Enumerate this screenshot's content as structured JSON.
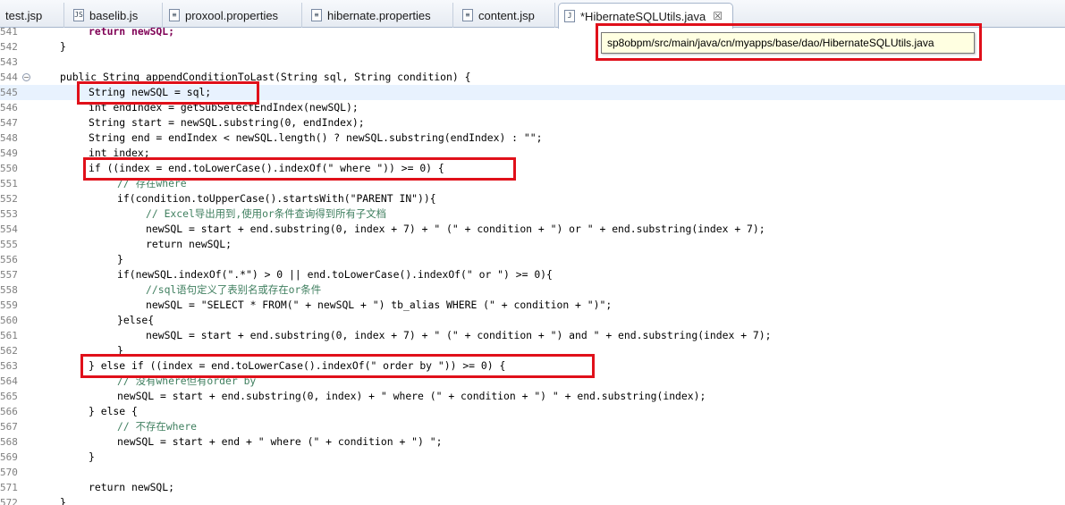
{
  "tabs": [
    {
      "label": "test.jsp",
      "icon": "jsp-file-icon"
    },
    {
      "label": "baselib.js",
      "icon": "js-file-icon"
    },
    {
      "label": "proxool.properties",
      "icon": "properties-file-icon"
    },
    {
      "label": "hibernate.properties",
      "icon": "properties-file-icon"
    },
    {
      "label": "content.jsp",
      "icon": "jsp-file-icon"
    },
    {
      "label": "*HibernateSQLUtils.java",
      "icon": "java-file-icon",
      "close": "☒"
    }
  ],
  "tooltip": "sp8obpm/src/main/java/cn/myapps/base/dao/HibernateSQLUtils.java",
  "annotation_color": "#e0101a",
  "current_line_color": "#e8f2fe",
  "lines": [
    {
      "num": "541",
      "code": "return newSQL;"
    },
    {
      "num": "542",
      "code": "}"
    },
    {
      "num": "543",
      "code": ""
    },
    {
      "num": "544",
      "code": "public String appendConditionToLast(String sql, String condition) {"
    },
    {
      "num": "545",
      "code": "String newSQL = sql;"
    },
    {
      "num": "546",
      "code": "int endIndex = getSubSelectEndIndex(newSQL);"
    },
    {
      "num": "547",
      "code": "String start = newSQL.substring(0, endIndex);"
    },
    {
      "num": "548",
      "code": "String end = endIndex < newSQL.length() ? newSQL.substring(endIndex) : \"\";"
    },
    {
      "num": "549",
      "code": "int index;"
    },
    {
      "num": "550",
      "code": "if ((index = end.toLowerCase().indexOf(\" where \")) >= 0) {"
    },
    {
      "num": "551",
      "code": "// 存在where"
    },
    {
      "num": "552",
      "code": "if(condition.toUpperCase().startsWith(\"PARENT IN\")){"
    },
    {
      "num": "553",
      "code": "// Excel导出用到,使用or条件查询得到所有子文档"
    },
    {
      "num": "554",
      "code": "newSQL = start + end.substring(0, index + 7) + \" (\" + condition + \") or \" + end.substring(index + 7);"
    },
    {
      "num": "555",
      "code": "return newSQL;"
    },
    {
      "num": "556",
      "code": "}"
    },
    {
      "num": "557",
      "code": "if(newSQL.indexOf(\".*\") > 0 || end.toLowerCase().indexOf(\" or \") >= 0){"
    },
    {
      "num": "558",
      "code": "//sql语句定义了表别名或存在or条件"
    },
    {
      "num": "559",
      "code": "newSQL = \"SELECT * FROM(\" + newSQL + \") tb_alias WHERE (\" + condition + \")\";"
    },
    {
      "num": "560",
      "code": "}else{"
    },
    {
      "num": "561",
      "code": "newSQL = start + end.substring(0, index + 7) + \" (\" + condition + \") and \" + end.substring(index + 7);"
    },
    {
      "num": "562",
      "code": "}"
    },
    {
      "num": "563",
      "code": "} else if ((index = end.toLowerCase().indexOf(\" order by \")) >= 0) {"
    },
    {
      "num": "564",
      "code": "// 没有where但有order by"
    },
    {
      "num": "565",
      "code": "newSQL = start + end.substring(0, index) + \" where (\" + condition + \") \" + end.substring(index);"
    },
    {
      "num": "566",
      "code": "} else {"
    },
    {
      "num": "567",
      "code": "// 不存在where"
    },
    {
      "num": "568",
      "code": "newSQL = start + end + \" where (\" + condition + \") \";"
    },
    {
      "num": "569",
      "code": "}"
    },
    {
      "num": "570",
      "code": ""
    },
    {
      "num": "571",
      "code": "return newSQL;"
    },
    {
      "num": "572",
      "code": "}"
    }
  ]
}
